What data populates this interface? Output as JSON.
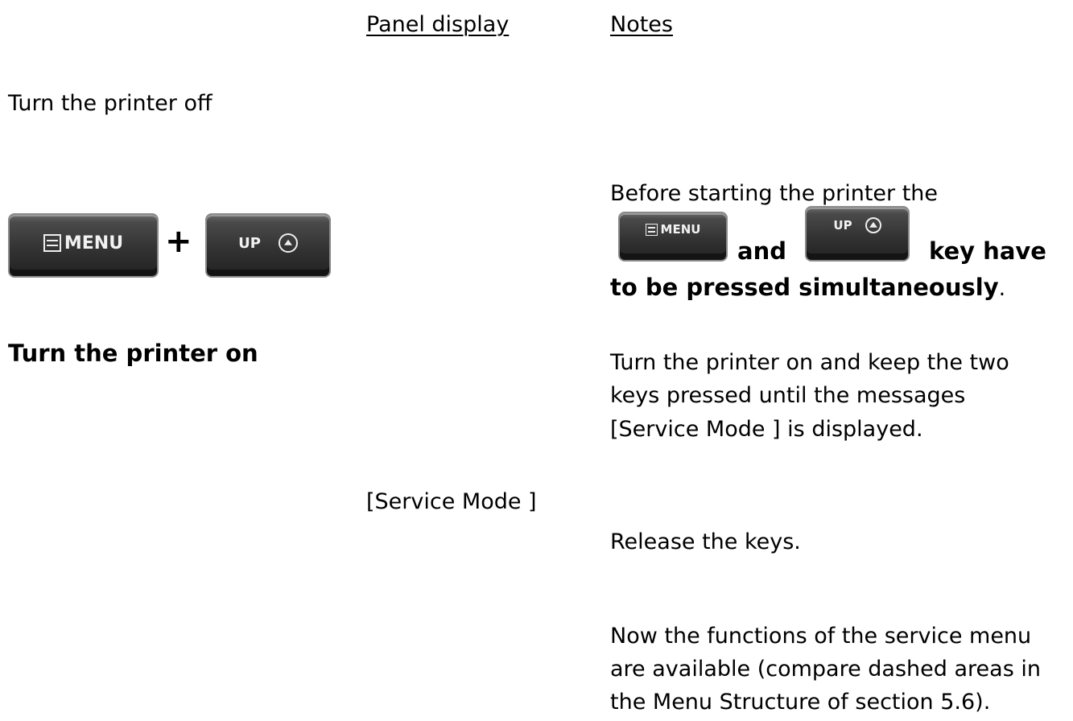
{
  "headers": {
    "panel_display": "Panel display",
    "notes": "Notes"
  },
  "steps": {
    "turn_off": "Turn the printer off",
    "turn_on": "Turn the printer on"
  },
  "keys": {
    "menu_label": "MENU",
    "up_label": "UP",
    "plus": "+"
  },
  "panel": {
    "service_mode": "[Service Mode  ]"
  },
  "notes": {
    "before_line1": "Before starting the printer the",
    "before_and": "and",
    "before_key_have": "key have",
    "before_line3_bold": "to be pressed simultaneously",
    "before_line3_end": ".",
    "turn_on_line1": "Turn the printer on and keep the two",
    "turn_on_line2": "keys pressed until the messages",
    "turn_on_line3": "[Service Mode ] is displayed.",
    "release": "Release the keys.",
    "now_line1": "Now the functions of the service menu",
    "now_line2": "are available (compare dashed areas in",
    "now_line3": "the Menu Structure of section 5.6)."
  }
}
